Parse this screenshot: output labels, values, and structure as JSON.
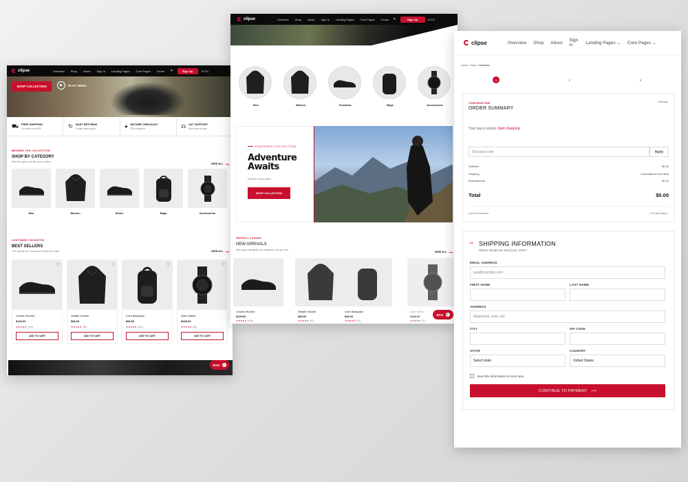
{
  "brand": {
    "logo_text": "clipse",
    "accent": "#c8102e",
    "dark": "#0b0b0b"
  },
  "nav": {
    "items": [
      "Overview",
      "Shop",
      "About",
      "Sign In",
      "Landing Pages",
      "Core Pages",
      "Forms"
    ],
    "signup": "Sign Up",
    "lang": "EN"
  },
  "home": {
    "hero": {
      "shop_btn": "SHOP COLLECTION",
      "play_btn": "PLAY VIDEO"
    },
    "features": [
      {
        "title": "FREE SHIPPING",
        "sub": "On orders over $75"
      },
      {
        "title": "EASY RETURNS",
        "sub": "30-day return policy"
      },
      {
        "title": "SECURE CHECKOUT",
        "sub": "SSL encrypted"
      },
      {
        "title": "24/7 SUPPORT",
        "sub": "We're here to help"
      }
    ],
    "category": {
      "eyebrow": "BROWSE THE COLLECTION",
      "title": "SHOP BY CATEGORY",
      "sub": "Find the gear that fits your routine",
      "view_all": "VIEW ALL",
      "items": [
        "Men",
        "Women",
        "Shoes",
        "Bags",
        "Accessories"
      ]
    },
    "best": {
      "eyebrow": "CUSTOMER FAVORITES",
      "title": "BEST SELLERS",
      "sub": "The pieces our customers reach for most",
      "view_all": "VIEW ALL",
      "add_label": "ADD TO CART",
      "products": [
        {
          "name": "Cosmic Runner",
          "price": "$129.00",
          "stars": "★★★★★",
          "reviews": "(203)"
        },
        {
          "name": "Stealth Hoodie",
          "price": "$85.00",
          "stars": "★★★★★",
          "reviews": "(96)"
        },
        {
          "name": "Core Backpack",
          "price": "$95.00",
          "stars": "★★★★★",
          "reviews": "(162)"
        },
        {
          "name": "Apex Watch",
          "price": "$159.00",
          "stars": "★★★★★",
          "reviews": "(88)"
        }
      ]
    },
    "bag": "BAG",
    "bag_count": "0"
  },
  "collections": {
    "cats": [
      "Men",
      "Women",
      "Footwear",
      "Bags",
      "Accessories"
    ],
    "featured": {
      "eyebrow": "FEATURED COLLECTION",
      "title_line1": "Adventure",
      "title_line2": "Awaits",
      "sub": "Built for every path.",
      "btn": "SHOP COLLECTION"
    },
    "arrivals": {
      "eyebrow": "FRESHLY LANDED",
      "title": "NEW ARRIVALS",
      "sub": "New gear, designed for whatever you go next",
      "view_all": "VIEW ALL",
      "products": [
        {
          "name": "Cosmic Runner",
          "price": "$129.00",
          "stars": "★★★★★",
          "reviews": "(108)"
        },
        {
          "name": "Stealth Hoodie",
          "price": "$85.00",
          "stars": "★★★★★",
          "reviews": "(50)"
        },
        {
          "name": "Core Backpack",
          "price": "$95.00",
          "stars": "★★★★★",
          "reviews": "(33)"
        },
        {
          "name": "Apex Watch",
          "price": "$180.00",
          "stars": "★★★★★",
          "reviews": "(21)"
        }
      ]
    },
    "bag": "BAG",
    "bag_count": "0"
  },
  "checkout": {
    "breadcrumb": [
      "Home",
      "Shop",
      "Checkout"
    ],
    "steps": [
      "1",
      "2",
      "3"
    ],
    "summary": {
      "eyebrow": "YOUR SELECTION",
      "title": "ORDER SUMMARY",
      "edit": "Edit bag",
      "empty_text": "Your bag is empty.",
      "empty_link": "Start shopping",
      "discount_placeholder": "Discount code",
      "apply": "Apply",
      "rows": [
        {
          "label": "Subtotal",
          "value": "$0.00"
        },
        {
          "label": "Shipping",
          "value": "Calculated at next step"
        },
        {
          "label": "Estimated tax",
          "value": "$0.00"
        }
      ],
      "total_label": "Total",
      "total_value": "$0.00",
      "secure": "Secure checkout",
      "returns": "30-day returns"
    },
    "shipping": {
      "num": "01",
      "title": "SHIPPING INFORMATION",
      "sub": "Where should we send your order?",
      "email_label": "EMAIL ADDRESS",
      "email_placeholder": "you@example.com",
      "first_label": "FIRST NAME",
      "last_label": "LAST NAME",
      "address_label": "ADDRESS",
      "address_placeholder": "Apartment, suite, etc.",
      "city_label": "CITY",
      "zip_label": "ZIP CODE",
      "state_label": "STATE",
      "state_value": "Select state",
      "country_label": "COUNTRY",
      "country_value": "United States",
      "save_label": "Save this information for next time",
      "continue": "CONTINUE TO PAYMENT"
    }
  }
}
